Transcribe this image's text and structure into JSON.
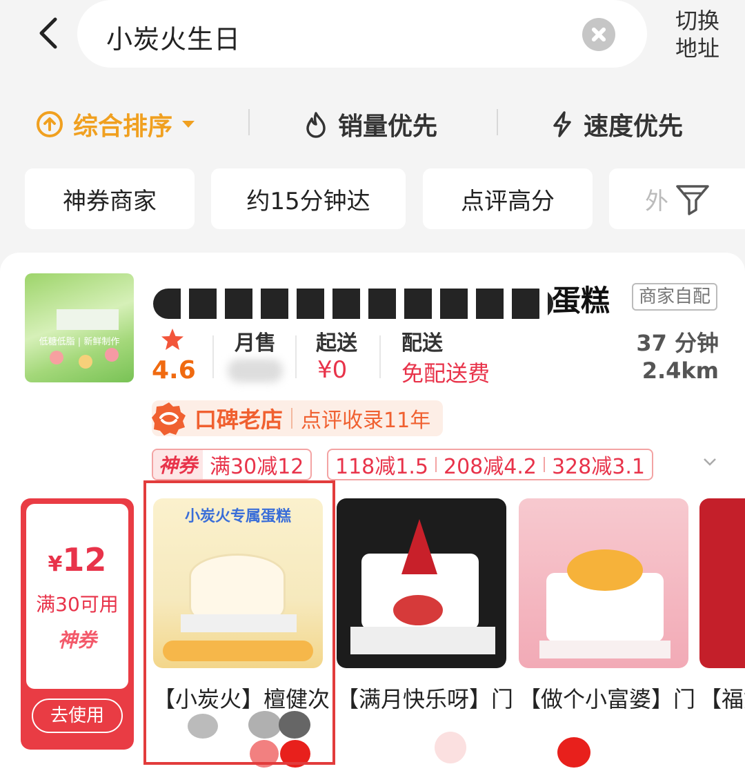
{
  "header": {
    "search_query": "小炭火生日",
    "switch_address": "切换\n地址"
  },
  "sort_tabs": [
    {
      "label": "综合排序",
      "active": true
    },
    {
      "label": "销量优先"
    },
    {
      "label": "速度优先"
    }
  ],
  "filter_chips": [
    "神券商家",
    "约15分钟达",
    "点评高分",
    "外"
  ],
  "shop": {
    "name_suffix": "蛋糕",
    "thumb_text": "低糖低脂 | 新鲜制作",
    "delivery_type": "商家自配",
    "rating": "4.6",
    "monthly_sales_label": "月售",
    "min_order_label": "起送",
    "min_order_value": "¥0",
    "delivery_label": "配送",
    "delivery_value": "免配送费",
    "eta": "37 分钟",
    "distance": "2.4km",
    "badge_main": "口碑老店",
    "badge_sub": "点评收录11年",
    "coupon_tag": "神券",
    "coupon_amount": "满30减12",
    "promos": [
      "118减1.5",
      "208减4.2",
      "328减3.1"
    ]
  },
  "voucher": {
    "currency": "¥",
    "amount": "12",
    "condition": "满30可用",
    "tag": "神券",
    "button": "去使用"
  },
  "products": [
    {
      "name": "【小炭火】檀健次",
      "image_caption": "小炭火专属蛋糕"
    },
    {
      "name": "【满月快乐呀】门"
    },
    {
      "name": "【做个小富婆】门"
    },
    {
      "name": "【福如"
    }
  ],
  "colors": {
    "accent": "#f0a020",
    "red": "#e8334a",
    "orange": "#f06a10"
  }
}
